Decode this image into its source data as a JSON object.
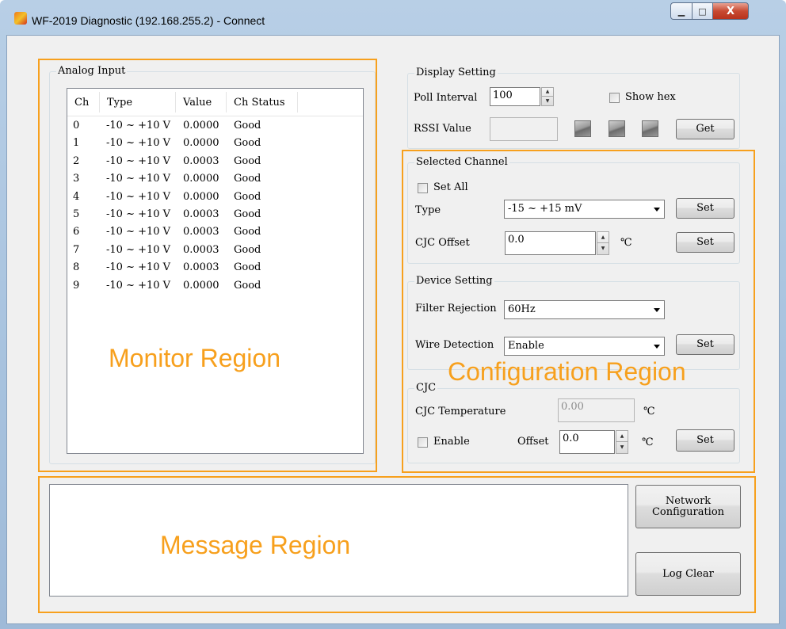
{
  "window": {
    "title": "WF-2019 Diagnostic (192.168.255.2) - Connect",
    "min_glyph": "▁",
    "max_glyph": "□",
    "close_glyph": "X"
  },
  "analog_input": {
    "group_label": "Analog Input",
    "columns": [
      "Ch",
      "Type",
      "Value",
      "Ch Status"
    ],
    "rows": [
      {
        "ch": "0",
        "type": "-10 ~ +10 V",
        "value": "0.0000",
        "status": "Good"
      },
      {
        "ch": "1",
        "type": "-10 ~ +10 V",
        "value": "0.0000",
        "status": "Good"
      },
      {
        "ch": "2",
        "type": "-10 ~ +10 V",
        "value": "0.0003",
        "status": "Good"
      },
      {
        "ch": "3",
        "type": "-10 ~ +10 V",
        "value": "0.0000",
        "status": "Good"
      },
      {
        "ch": "4",
        "type": "-10 ~ +10 V",
        "value": "0.0000",
        "status": "Good"
      },
      {
        "ch": "5",
        "type": "-10 ~ +10 V",
        "value": "0.0003",
        "status": "Good"
      },
      {
        "ch": "6",
        "type": "-10 ~ +10 V",
        "value": "0.0003",
        "status": "Good"
      },
      {
        "ch": "7",
        "type": "-10 ~ +10 V",
        "value": "0.0003",
        "status": "Good"
      },
      {
        "ch": "8",
        "type": "-10 ~ +10 V",
        "value": "0.0003",
        "status": "Good"
      },
      {
        "ch": "9",
        "type": "-10 ~ +10 V",
        "value": "0.0000",
        "status": "Good"
      }
    ]
  },
  "display_setting": {
    "group_label": "Display Setting",
    "poll_interval_label": "Poll Interval",
    "poll_interval_value": "100",
    "show_hex_label": "Show hex",
    "rssi_label": "RSSI Value",
    "rssi_value": "",
    "get_button": "Get"
  },
  "selected_channel": {
    "group_label": "Selected Channel",
    "set_all_label": "Set All",
    "type_label": "Type",
    "type_value": "-15 ~ +15 mV",
    "type_set_button": "Set",
    "cjc_offset_label": "CJC Offset",
    "cjc_offset_value": "0.0",
    "cjc_offset_unit": "℃",
    "cjc_offset_set_button": "Set"
  },
  "device_setting": {
    "group_label": "Device Setting",
    "filter_rejection_label": "Filter Rejection",
    "filter_rejection_value": "60Hz",
    "wire_detection_label": "Wire Detection",
    "wire_detection_value": "Enable",
    "wire_detection_set_button": "Set"
  },
  "cjc": {
    "group_label": "CJC",
    "temperature_label": "CJC Temperature",
    "temperature_value": "0.00",
    "temperature_unit": "℃",
    "enable_label": "Enable",
    "offset_label": "Offset",
    "offset_value": "0.0",
    "offset_unit": "℃",
    "set_button": "Set"
  },
  "message": {
    "log_text": "",
    "network_config_button_line1": "Network",
    "network_config_button_line2": "Configuration",
    "log_clear_button": "Log Clear"
  },
  "annotations": {
    "monitor": "Monitor Region",
    "configuration": "Configuration  Region",
    "message": "Message Region",
    "color": "#f7a01d"
  }
}
